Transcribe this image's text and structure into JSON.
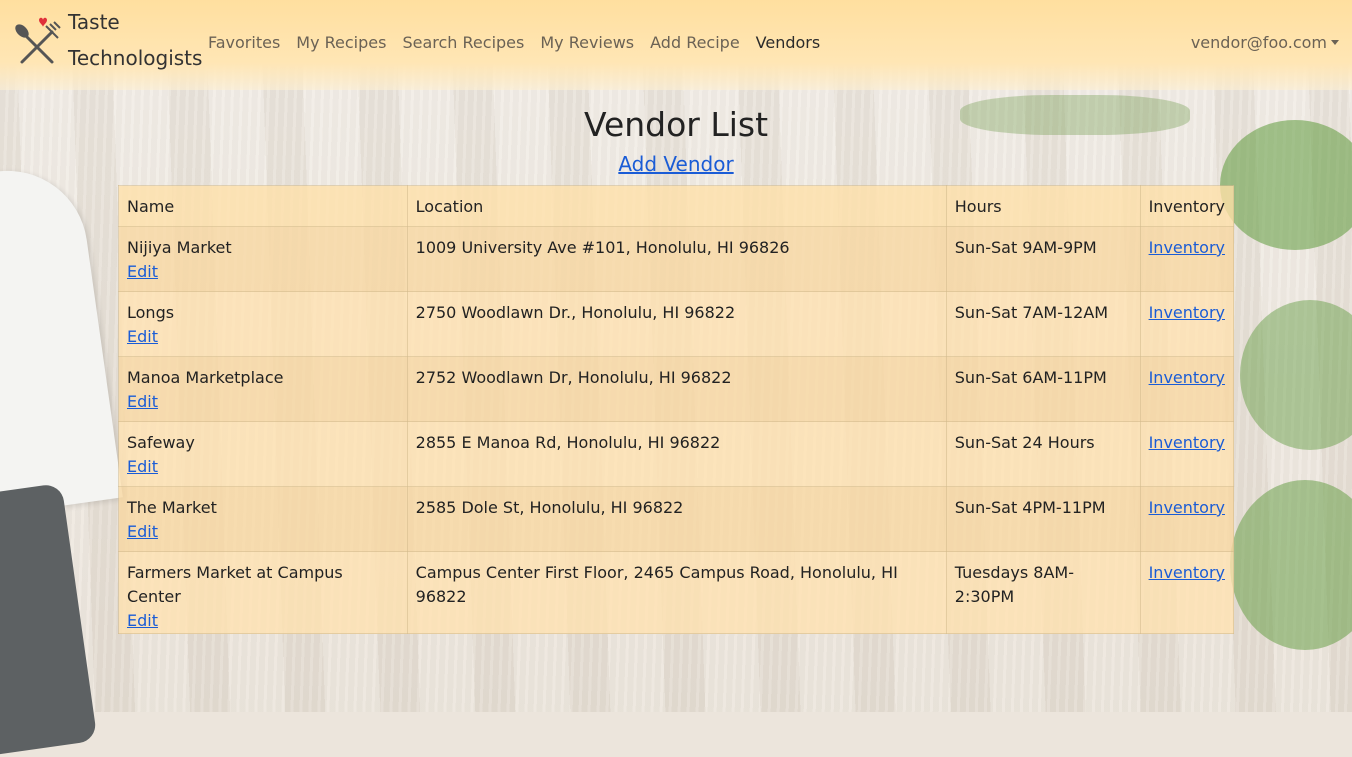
{
  "brand": {
    "line1": "Taste",
    "line2": "Technologists"
  },
  "nav": {
    "items": [
      {
        "label": "Favorites"
      },
      {
        "label": "My Recipes"
      },
      {
        "label": "Search Recipes"
      },
      {
        "label": "My Reviews"
      },
      {
        "label": "Add Recipe"
      },
      {
        "label": "Vendors"
      }
    ],
    "active": "Vendors",
    "user": "vendor@foo.com"
  },
  "page": {
    "title": "Vendor List",
    "add_link": "Add Vendor"
  },
  "table": {
    "headers": [
      "Name",
      "Location",
      "Hours",
      "Inventory"
    ],
    "rows": [
      {
        "name": "Nijiya Market",
        "location": "1009 University Ave #101, Honolulu, HI 96826",
        "hours": "Sun-Sat 9AM-9PM",
        "edit": "Edit",
        "inventory": "Inventory"
      },
      {
        "name": "Longs",
        "location": "2750 Woodlawn Dr., Honolulu, HI 96822",
        "hours": "Sun-Sat 7AM-12AM",
        "edit": "Edit",
        "inventory": "Inventory"
      },
      {
        "name": "Manoa Marketplace",
        "location": "2752 Woodlawn Dr, Honolulu, HI 96822",
        "hours": "Sun-Sat 6AM-11PM",
        "edit": "Edit",
        "inventory": "Inventory"
      },
      {
        "name": "Safeway",
        "location": "2855 E Manoa Rd, Honolulu, HI 96822",
        "hours": "Sun-Sat 24 Hours",
        "edit": "Edit",
        "inventory": "Inventory"
      },
      {
        "name": "The Market",
        "location": "2585 Dole St, Honolulu, HI 96822",
        "hours": "Sun-Sat 4PM-11PM",
        "edit": "Edit",
        "inventory": "Inventory"
      },
      {
        "name": "Farmers Market at Campus Center",
        "location": "Campus Center First Floor, 2465 Campus Road, Honolulu, HI 96822",
        "hours": "Tuesdays 8AM-2:30PM",
        "edit": "Edit",
        "inventory": "Inventory"
      }
    ]
  },
  "colors": {
    "navbar": "#ffdf9f",
    "link": "#1a5cd6",
    "row_odd": "#f8d7a0",
    "row_even": "#ffe2af",
    "heart": "#e0303a"
  },
  "icons": {
    "logo": "fork-knife-heart-icon",
    "user_caret": "caret-down-icon"
  }
}
